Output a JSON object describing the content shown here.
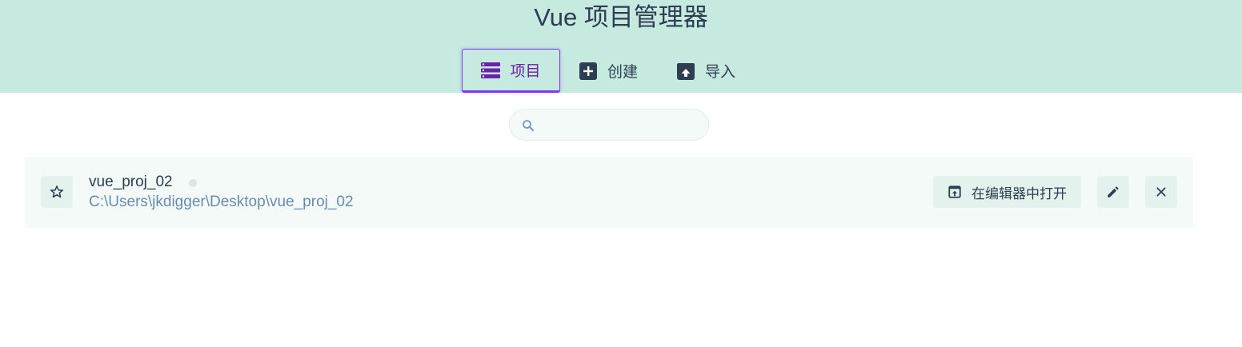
{
  "app": {
    "title": "Vue 项目管理器"
  },
  "tabs": [
    {
      "label": "项目",
      "icon": "list-icon",
      "active": true
    },
    {
      "label": "创建",
      "icon": "add-box-icon",
      "active": false
    },
    {
      "label": "导入",
      "icon": "unarchive-icon",
      "active": false
    }
  ],
  "search": {
    "value": "",
    "placeholder": "",
    "icon": "search-icon"
  },
  "projects": [
    {
      "name": "vue_proj_02",
      "path": "C:\\Users\\jkdigger\\Desktop\\vue_proj_02",
      "favorite": false,
      "open_in_editor_label": "在编辑器中打开"
    }
  ],
  "colors": {
    "header_bg": "#c6eadf",
    "accent": "#7c3aed",
    "text": "#2c3e50",
    "path_text": "#6a8bad",
    "row_bg": "#f4faf8",
    "button_bg": "#e4f2ed"
  }
}
